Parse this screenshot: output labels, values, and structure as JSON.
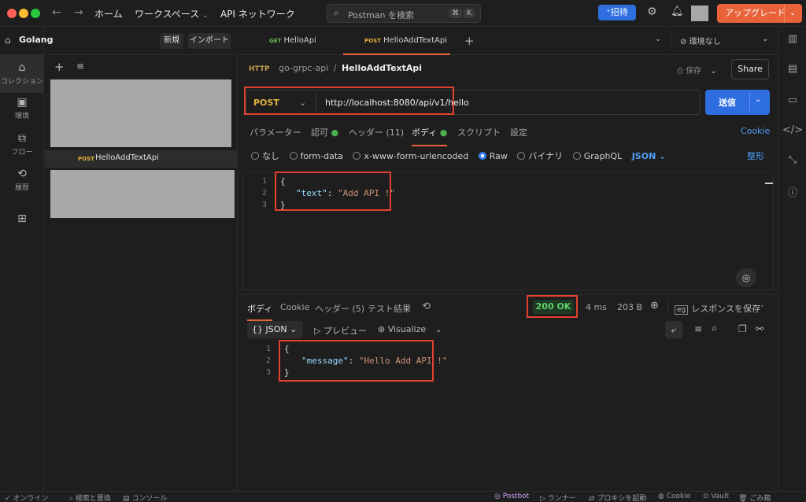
{
  "titlebar": {
    "home": "ホーム",
    "workspace": "ワークスペース",
    "api_network": "API ネットワーク",
    "search_placeholder": "Postman を検索",
    "kbd1": "⌘",
    "kbd2": "K",
    "invite": "招待",
    "upgrade": "アップグレード"
  },
  "workspace": {
    "name": "Golang",
    "new": "新規",
    "import": "インポート"
  },
  "rail": [
    {
      "label": "コレクション",
      "icon": "collection-icon"
    },
    {
      "label": "環境",
      "icon": "environment-icon"
    },
    {
      "label": "フロー",
      "icon": "flow-icon"
    },
    {
      "label": "履歴",
      "icon": "history-icon"
    }
  ],
  "sidebar": {
    "method": "POST",
    "item": "HelloAddTextApi"
  },
  "tabs": [
    {
      "method": "GET",
      "label": "HelloApi"
    },
    {
      "method": "POST",
      "label": "HelloAddTextApi"
    }
  ],
  "env": {
    "label": "環境なし"
  },
  "breadcrumb": {
    "collection": "go-grpc-api",
    "sep": "/",
    "request": "HelloAddTextApi"
  },
  "actions": {
    "save": "保存",
    "share": "Share"
  },
  "request": {
    "method": "POST",
    "url": "http://localhost:8080/api/v1/hello",
    "send": "送信"
  },
  "req_tabs": {
    "params": "パラメーター",
    "auth": "認可",
    "headers": "ヘッダー (11)",
    "body": "ボディ",
    "scripts": "スクリプト",
    "settings": "設定",
    "cookie": "Cookie"
  },
  "body_types": {
    "none": "なし",
    "form_data": "form-data",
    "urlencoded": "x-www-form-urlencoded",
    "raw": "Raw",
    "binary": "バイナリ",
    "graphql": "GraphQL",
    "json": "JSON",
    "beautify": "整形"
  },
  "req_body": {
    "lines": [
      "1",
      "2",
      "3"
    ],
    "open": "{",
    "key": "\"text\"",
    "colon": ": ",
    "value": "\"Add API !\"",
    "close": "}"
  },
  "response": {
    "tabs": {
      "body": "ボディ",
      "cookie": "Cookie",
      "headers": "ヘッダー (5)",
      "tests": "テスト結果"
    },
    "status": "200 OK",
    "time": "4 ms",
    "size": "203 B",
    "save": "レスポンスを保存",
    "format": "JSON",
    "preview": "プレビュー",
    "visualize": "Visualize",
    "lines": [
      "1",
      "2",
      "3"
    ],
    "open": "{",
    "key": "\"message\"",
    "colon": ": ",
    "value": "\"Hello Add API !\"",
    "close": "}"
  },
  "statusbar": {
    "online": "オンライン",
    "find": "検索と置換",
    "console": "コンソール",
    "postbot": "Postbot",
    "runner": "ランナー",
    "proxy": "プロキシを起動",
    "cookie": "Cookie",
    "vault": "Vault",
    "trash": "ごみ箱"
  },
  "colors": {
    "accent": "#2f6ee0",
    "upgrade": "#e8623a",
    "post": "#e5b23b",
    "get": "#6bbf59",
    "ok": "#4caf50",
    "highlight": "#e0412f"
  }
}
